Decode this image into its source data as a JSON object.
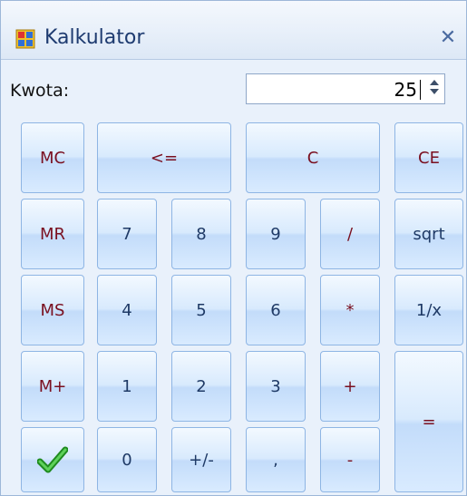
{
  "window": {
    "title": "Kalkulator"
  },
  "input": {
    "label": "Kwota:",
    "value": "25"
  },
  "buttons": {
    "mc": "MC",
    "backspace": "<=",
    "c": "C",
    "ce": "CE",
    "mr": "MR",
    "ms": "MS",
    "mplus": "M+",
    "n7": "7",
    "n8": "8",
    "n9": "9",
    "div": "/",
    "sqrt": "sqrt",
    "n4": "4",
    "n5": "5",
    "n6": "6",
    "mul": "*",
    "inv": "1/x",
    "n1": "1",
    "n2": "2",
    "n3": "3",
    "add": "+",
    "n0": "0",
    "sign": "+/-",
    "comma": ",",
    "sub": "-",
    "eq": "=",
    "ok_icon": "checkmark-icon"
  }
}
